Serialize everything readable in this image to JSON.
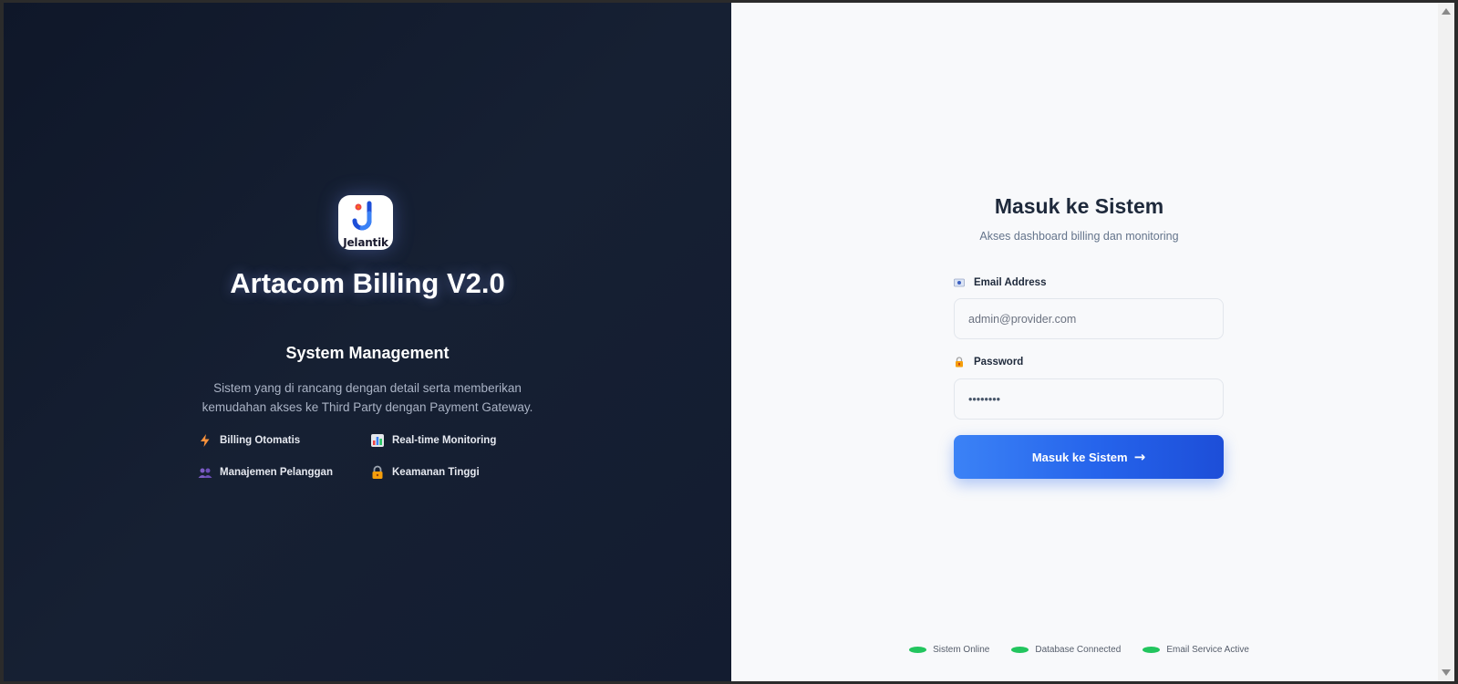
{
  "brand": {
    "logo_text": "Jelantik",
    "title": "Artacom Billing V2.0",
    "subtitle": "System Management",
    "description": "Sistem yang di rancang dengan detail serta memberikan kemudahan akses ke Third Party dengan Payment Gateway."
  },
  "features": [
    {
      "label": "Billing Otomatis",
      "icon": "lightning-icon"
    },
    {
      "label": "Real-time Monitoring",
      "icon": "bar-chart-icon"
    },
    {
      "label": "Manajemen Pelanggan",
      "icon": "users-icon"
    },
    {
      "label": "Keamanan Tinggi",
      "icon": "lock-icon"
    }
  ],
  "login": {
    "title": "Masuk ke Sistem",
    "subtitle": "Akses dashboard billing dan monitoring",
    "email_label": "Email Address",
    "email_placeholder": "admin@provider.com",
    "password_label": "Password",
    "password_value": "••••••••",
    "submit_label": "Masuk ke Sistem",
    "submit_arrow": "→"
  },
  "status": [
    {
      "label": "Sistem Online"
    },
    {
      "label": "Database Connected"
    },
    {
      "label": "Email Service Active"
    }
  ],
  "colors": {
    "left_bg": "#0f1729",
    "right_bg": "#f8f9fb",
    "accent": "#2563eb",
    "status_ok": "#22c55e"
  }
}
